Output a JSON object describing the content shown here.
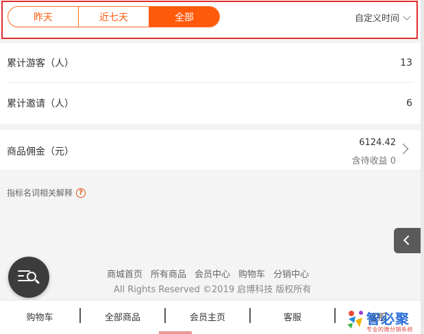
{
  "filter": {
    "tabs": [
      {
        "label": "昨天",
        "active": false
      },
      {
        "label": "近七天",
        "active": false
      },
      {
        "label": "全部",
        "active": true
      }
    ],
    "custom_time_label": "自定义时间"
  },
  "stats": {
    "visitors_label": "累计游客（人）",
    "visitors_value": "13",
    "invites_label": "累计邀请（人）",
    "invites_value": "6"
  },
  "commission": {
    "label": "商品佣金（元）",
    "amount": "6124.42",
    "pending": "含待收益 0"
  },
  "explain": {
    "label": "指标名词相关解释",
    "icon_char": "?"
  },
  "footer": {
    "links": [
      "商城首页",
      "所有商品",
      "会员中心",
      "购物车",
      "分销中心"
    ],
    "copyright": "All Rights Reserved ©2019 启博科技 版权所有"
  },
  "bottom_nav": [
    "购物车",
    "全部商品",
    "会员主页",
    "客服",
    "客服"
  ],
  "watermark": {
    "title": "智必聚",
    "subtitle": "专业的微分销系统"
  },
  "colors": {
    "accent": "#ff5a0a",
    "highlight_border": "#e02b2b"
  }
}
